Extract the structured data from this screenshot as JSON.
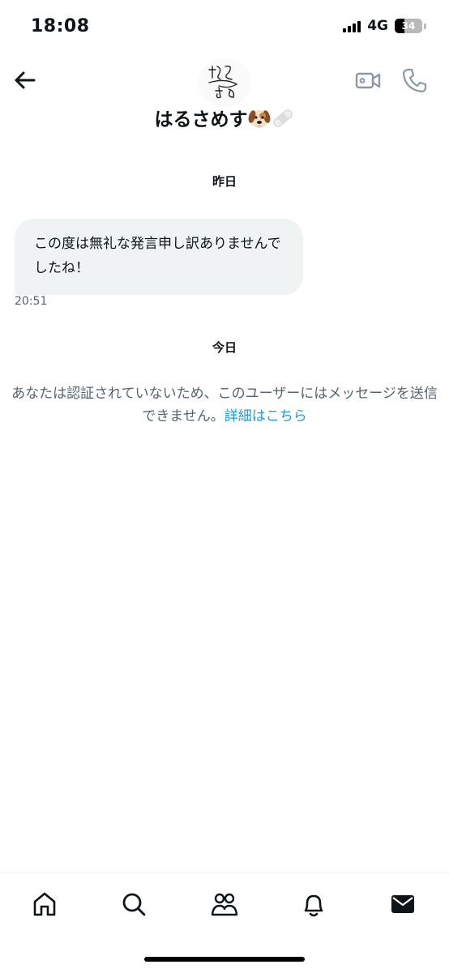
{
  "status_bar": {
    "time": "18:08",
    "network": "4G",
    "battery": "34",
    "battery_level": 0.34
  },
  "header": {
    "name": "はるさめす",
    "avatar_text": "はる さめ"
  },
  "chat": {
    "date_yesterday": "昨日",
    "messages": [
      {
        "text": "この度は無礼な発言申し訳ありませんでしたね！",
        "time": "20:51"
      }
    ],
    "date_today": "今日",
    "notice_text": "あなたは認証されていないため、このユーザーにはメッセージを送信できません。",
    "notice_link": "詳細はこちら"
  },
  "tabbar": {
    "items": [
      {
        "icon": "home-icon"
      },
      {
        "icon": "search-icon"
      },
      {
        "icon": "communities-icon"
      },
      {
        "icon": "notifications-icon"
      },
      {
        "icon": "messages-icon"
      }
    ]
  }
}
